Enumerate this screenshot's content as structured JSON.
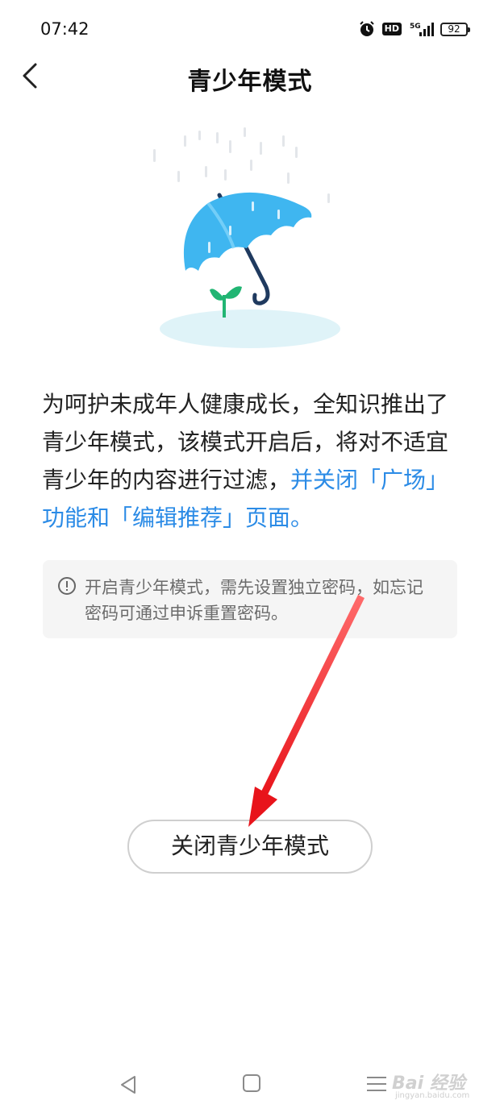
{
  "status_bar": {
    "time": "07:42",
    "hd_label": "HD",
    "network_label": "5G",
    "battery_level": "92",
    "icons": [
      "alarm-icon",
      "hd-icon",
      "signal-icon",
      "battery-icon"
    ]
  },
  "header": {
    "back_icon": "chevron-left-icon",
    "title": "青少年模式"
  },
  "illustration": {
    "subject": "umbrella-sprout-illustration",
    "colors": {
      "umbrella": "#3fb6f0",
      "handle": "#1f3a5f",
      "sprout": "#21b573",
      "ground": "#dff3f8"
    }
  },
  "description": {
    "text": "为呵护未成年人健康成长，全知识推出了青少年模式，该模式开启后，将对不适宜青少年的内容进行过滤，",
    "link_text": "并关闭「广场」功能和「编辑推荐」页面。",
    "link_color": "#2b8be6"
  },
  "notice": {
    "icon": "info-circle-icon",
    "text": "开启青少年模式，需先设置独立密码，如忘记密码可通过申诉重置密码。"
  },
  "actions": {
    "close_label": "关闭青少年模式"
  },
  "annotation": {
    "arrow_color": "#e8141b"
  },
  "nav_bar": {
    "icons": [
      "nav-back-icon",
      "nav-home-icon",
      "nav-menu-icon"
    ]
  },
  "watermark": {
    "brand": "Bai 经验",
    "url": "jingyan.baidu.com"
  }
}
